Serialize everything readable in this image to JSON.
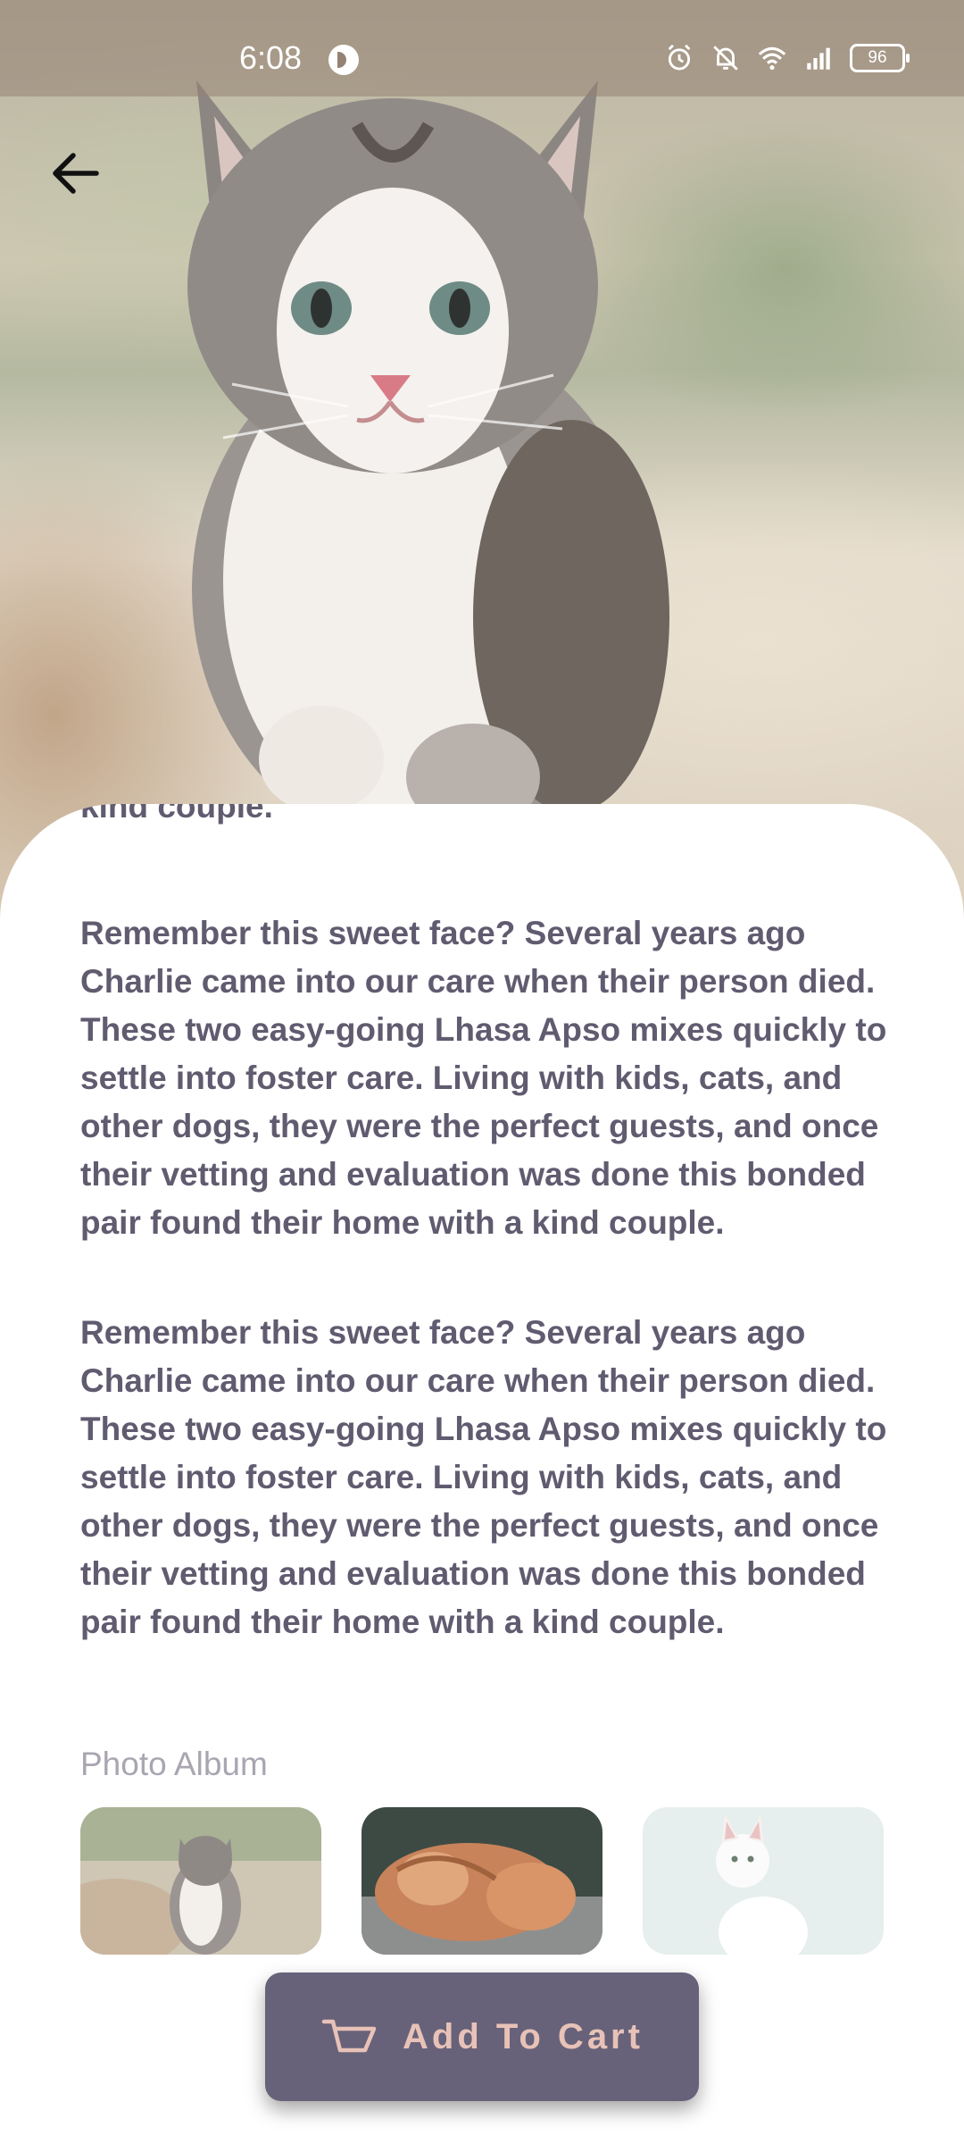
{
  "status_bar": {
    "time": "6:08",
    "battery": "96"
  },
  "description": {
    "cut_line": "kind couple.",
    "paragraphs": [
      "Remember this sweet face? Several years ago Charlie came into our care when their person died. These two easy-going Lhasa Apso mixes quickly to settle into foster care. Living with kids, cats, and other dogs, they were the perfect guests, and once their vetting and evaluation was done this bonded pair found their home with a kind couple.",
      "Remember this sweet face? Several years ago Charlie came into our care when their person died. These two easy-going Lhasa Apso mixes quickly to settle into foster care. Living with kids, cats, and other dogs, they were the perfect guests, and once their vetting and evaluation was done this bonded pair found their home with a kind couple."
    ]
  },
  "album": {
    "title": "Photo Album"
  },
  "cart": {
    "label": "Add To Cart"
  },
  "colors": {
    "text": "#615b70",
    "button": "#67627a",
    "button_text": "#e8c2b7",
    "muted": "#a9a5b1"
  }
}
